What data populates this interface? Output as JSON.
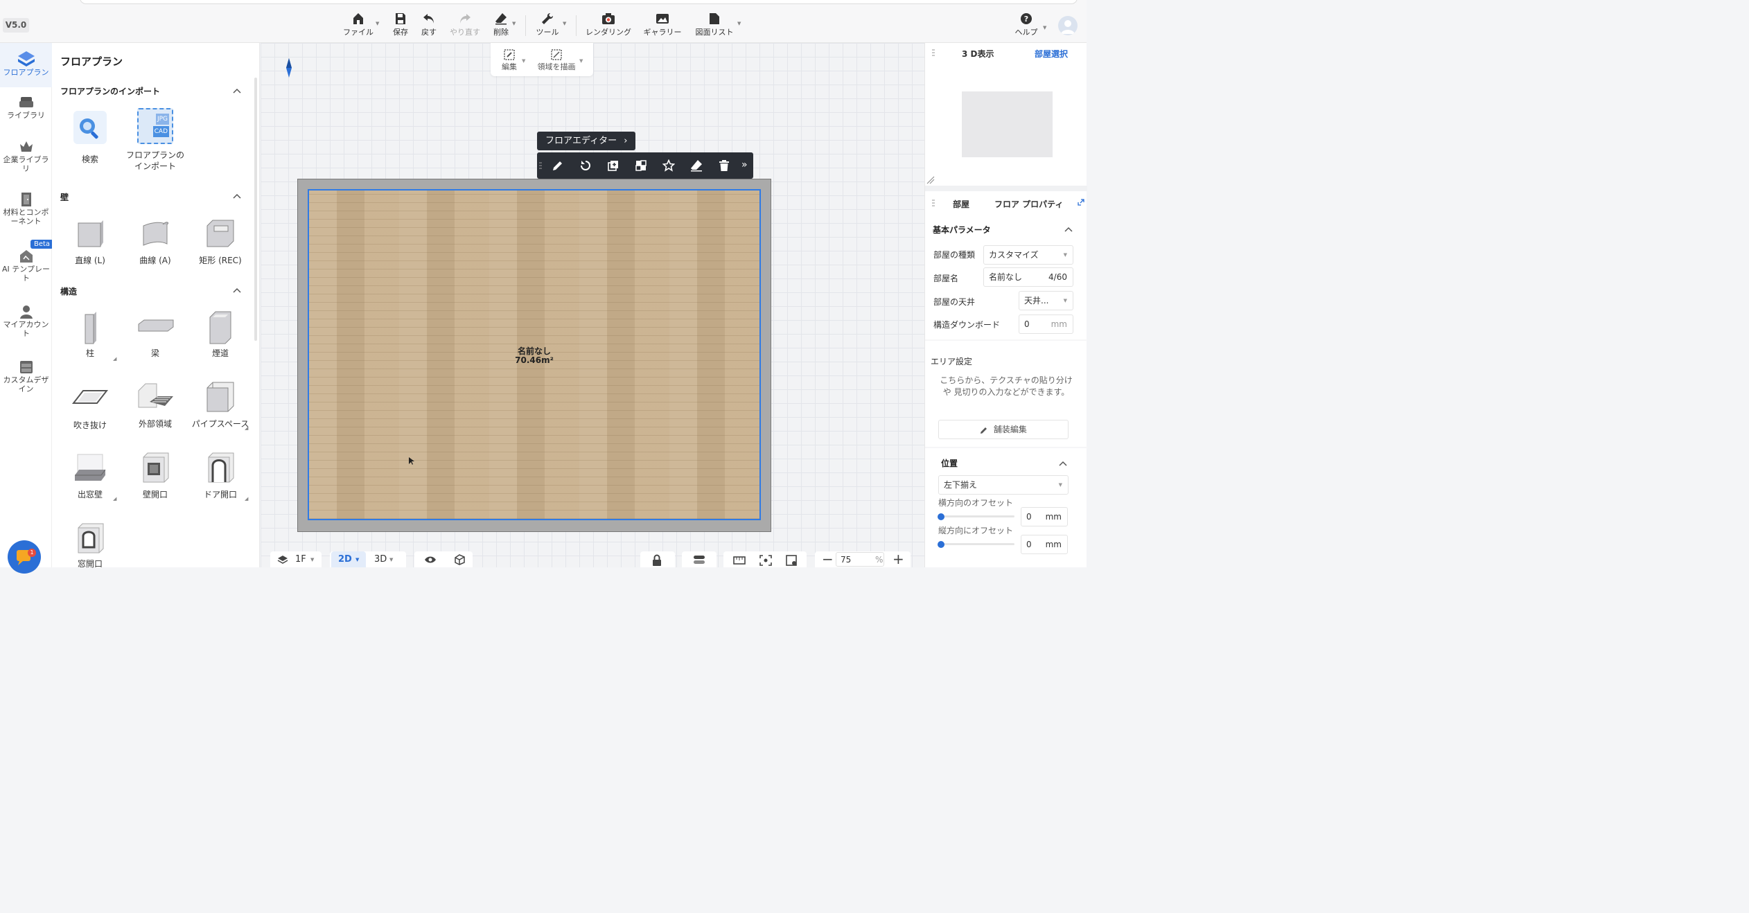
{
  "app": {
    "version": "V5.0"
  },
  "toolbar": {
    "file": "ファイル",
    "save": "保存",
    "undo": "戻す",
    "redo": "やり直す",
    "delete": "削除",
    "tools": "ツール",
    "rendering": "レンダリング",
    "gallery": "ギャラリー",
    "drawing_list": "図面リスト",
    "help": "ヘルプ"
  },
  "rail": {
    "items": [
      {
        "label": "フロアプラン"
      },
      {
        "label": "ライブラリ"
      },
      {
        "label": "企業ライブラリ"
      },
      {
        "label": "材料とコンポーネント"
      },
      {
        "label": "AI テンプレート"
      },
      {
        "label": "マイアカウント"
      },
      {
        "label": "カスタムデザイン"
      }
    ],
    "beta": "Beta"
  },
  "library": {
    "title": "フロアプラン",
    "import_section": "フロアプランのインポート",
    "search": "検索",
    "import_floorplan": "フロアプランのインポート",
    "import_badge_top": "JPG",
    "import_badge_bottom": "CAD",
    "wall_section": "壁",
    "walls": [
      "直線 (L)",
      "曲線 (A)",
      "矩形 (REC)"
    ],
    "structure_section": "構造",
    "structures": [
      "柱",
      "梁",
      "煙道",
      "吹き抜け",
      "外部領域",
      "パイプスペース",
      "出窓壁",
      "壁開口",
      "ドア開口",
      "窓開口"
    ]
  },
  "canvas": {
    "edit": "編集",
    "draw_area": "領域を描画",
    "floor_editor": "フロアエディター",
    "room_name": "名前なし",
    "room_area": "70.46m²",
    "floor": "1F",
    "view2d": "2D",
    "view3d": "3D",
    "zoom": "75",
    "zoom_unit": "%"
  },
  "right": {
    "view3d": "3 D表示",
    "select_room": "部屋選択",
    "tab_room": "部屋",
    "tab_floor": "フロア プロパティ",
    "basic_params": "基本パラメータ",
    "room_type_label": "部屋の種類",
    "room_type_value": "カスタマイズ",
    "room_name_label": "部屋名",
    "room_name_value": "名前なし",
    "room_name_count": "4/60",
    "ceiling_label": "部屋の天井",
    "ceiling_value": "天井...",
    "downboard_label": "構造ダウンボード",
    "downboard_value": "0",
    "unit_mm": "mm",
    "area_settings": "エリア設定",
    "area_help": "こちらから、テクスチャの貼り分けや 見切りの入力などができます。",
    "pavement_edit": "舗装編集",
    "position": "位置",
    "align_value": "左下揃え",
    "h_offset_label": "横方向のオフセット",
    "h_offset_value": "0",
    "v_offset_label": "縦方向にオフセット",
    "v_offset_value": "0"
  },
  "chat": {
    "badge": "1"
  }
}
